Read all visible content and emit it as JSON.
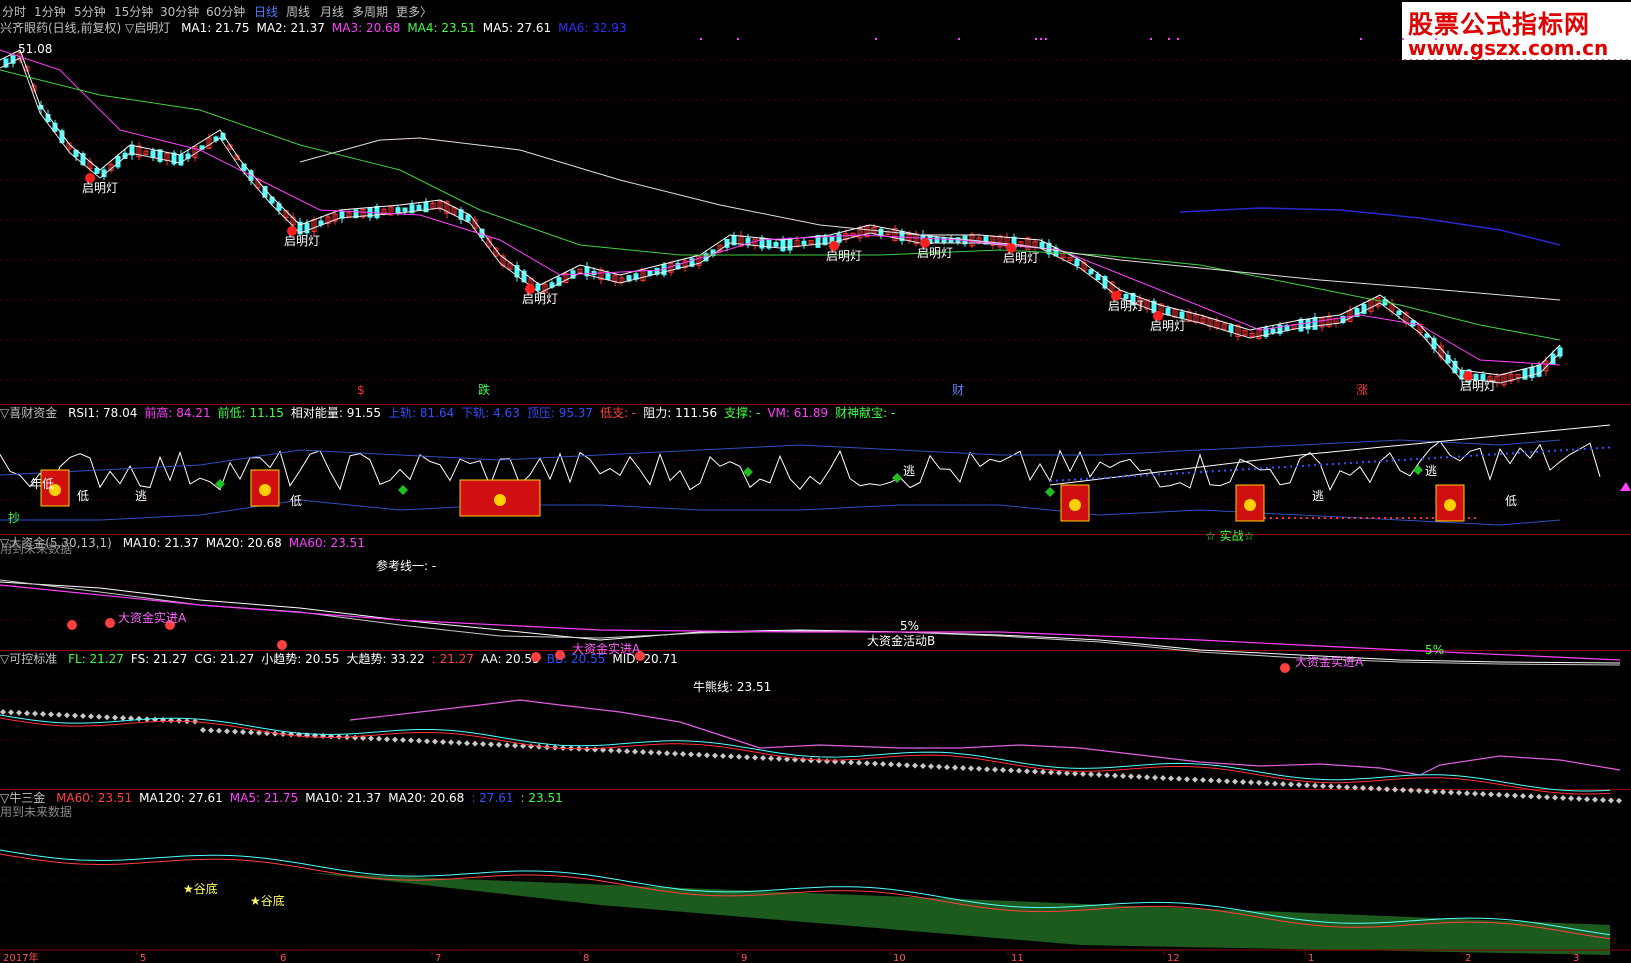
{
  "toolbar": {
    "tabs": [
      {
        "label": "分时"
      },
      {
        "label": "1分钟"
      },
      {
        "label": "5分钟"
      },
      {
        "label": "15分钟"
      },
      {
        "label": "30分钟"
      },
      {
        "label": "60分钟"
      },
      {
        "label": "日线",
        "active": true
      },
      {
        "label": "周线"
      },
      {
        "label": "月线"
      },
      {
        "label": "多周期"
      },
      {
        "label": "更多〉"
      }
    ]
  },
  "logo": {
    "line1": "股票公式指标网",
    "line2": "www.gszx.com.cn"
  },
  "panel1": {
    "title": "兴齐眼药(日线,前复权) ▽启明灯",
    "ma": [
      {
        "label": "MA1: 21.75",
        "color": "#ffffff"
      },
      {
        "label": "MA2: 21.37",
        "color": "#ffffff"
      },
      {
        "label": "MA3: 20.68",
        "color": "#ff40ff"
      },
      {
        "label": "MA4: 23.51",
        "color": "#40ff40"
      },
      {
        "label": "MA5: 27.61",
        "color": "#ffffff"
      },
      {
        "label": "MA6: 32.93",
        "color": "#3030ff"
      }
    ],
    "high_label": "51.08",
    "signal_label": "启明灯",
    "markers": [
      {
        "text": "$",
        "color": "#ff3030"
      },
      {
        "text": "跌",
        "color": "#40ff40"
      },
      {
        "text": "财",
        "color": "#6080ff"
      },
      {
        "text": "涨",
        "color": "#ff3030"
      }
    ]
  },
  "panel2": {
    "title": "▽喜财资金",
    "items": [
      {
        "label": "RSI1: 78.04",
        "color": "#ffffff"
      },
      {
        "label": "前高: 84.21",
        "color": "#ff40ff"
      },
      {
        "label": "前低: 11.15",
        "color": "#40ff40"
      },
      {
        "label": "相对能量: 91.55",
        "color": "#ffffff"
      },
      {
        "label": "上轨: 81.64",
        "color": "#3050ff"
      },
      {
        "label": "下轨: 4.63",
        "color": "#3050ff"
      },
      {
        "label": "顶压: 95.37",
        "color": "#3050ff"
      },
      {
        "label": "低支: -",
        "color": "#ff4040"
      },
      {
        "label": "阻力: 111.56",
        "color": "#ffffff"
      },
      {
        "label": "支撑: -",
        "color": "#40ff40"
      },
      {
        "label": "VM: 61.89",
        "color": "#ff40ff"
      },
      {
        "label": "财神献宝: -",
        "color": "#40ff40"
      }
    ],
    "future_note": "用到未来数据",
    "labels": {
      "nian_di": "年低",
      "di": "低",
      "tao": "逃",
      "chao": "抄",
      "shizhan": "☆ 实战☆"
    }
  },
  "panel3": {
    "title": "▽大资金(5,30,13,1)",
    "items": [
      {
        "label": "MA10: 21.37",
        "color": "#ffffff"
      },
      {
        "label": "MA20: 20.68",
        "color": "#ffffff"
      },
      {
        "label": "MA60: 23.51",
        "color": "#ff40ff"
      }
    ],
    "ref_line": "参考线一: -",
    "labels": {
      "a": "大资金实进A",
      "b": "大资金活动B",
      "pct": "5%"
    }
  },
  "panel4": {
    "title": "▽可控标准",
    "items": [
      {
        "label": "FL: 21.27",
        "color": "#40ff40"
      },
      {
        "label": "FS: 21.27",
        "color": "#ffffff"
      },
      {
        "label": "CG: 21.27",
        "color": "#ffffff"
      },
      {
        "label": "小趋势: 20.55",
        "color": "#ffffff"
      },
      {
        "label": "大趋势: 33.22",
        "color": "#ffffff"
      },
      {
        "label": ": 21.27",
        "color": "#ff4040"
      },
      {
        "label": "AA: 20.55",
        "color": "#ffffff"
      },
      {
        "label": "BB: 20.55",
        "color": "#3050ff"
      },
      {
        "label": "MID: 20.71",
        "color": "#ffffff"
      }
    ],
    "niu_line": "牛熊线: 23.51",
    "future_note": "用到未来数据"
  },
  "panel5": {
    "title": "▽牛三金",
    "items": [
      {
        "label": "MA60: 23.51",
        "color": "#ff4040"
      },
      {
        "label": "MA120: 27.61",
        "color": "#ffffff"
      },
      {
        "label": "MA5: 21.75",
        "color": "#ff40ff"
      },
      {
        "label": "MA10: 21.37",
        "color": "#ffffff"
      },
      {
        "label": "MA20: 20.68",
        "color": "#ffffff"
      }
    ],
    "extra": [
      {
        "label": ": 27.61",
        "color": "#3050ff"
      },
      {
        "label": ": 23.51",
        "color": "#40ff40"
      }
    ],
    "labels": {
      "gudi": "谷底"
    }
  },
  "xaxis": {
    "labels": [
      "2017年",
      "5",
      "6",
      "7",
      "8",
      "9",
      "10",
      "11",
      "12",
      "1",
      "2",
      "3"
    ]
  },
  "chart_data": {
    "type": "line",
    "title": "兴齐眼药(日线,前复权)",
    "xlabel": "",
    "ylabel": "",
    "series": [
      {
        "name": "MA5",
        "values": [
          48,
          45,
          40,
          36,
          33,
          32,
          31,
          30,
          28,
          24,
          23,
          22,
          21,
          22,
          23,
          21,
          19,
          18,
          17,
          16,
          15,
          17,
          14,
          13,
          21.75
        ]
      },
      {
        "name": "MA20",
        "values": [
          49,
          47,
          44,
          40,
          37,
          34,
          33,
          31,
          29,
          26,
          24,
          23,
          22,
          22,
          22,
          22,
          20,
          19,
          18,
          17,
          16,
          16,
          15,
          14,
          20.68
        ]
      },
      {
        "name": "MA60",
        "values": [
          50,
          49,
          47,
          45,
          43,
          41,
          39,
          36,
          33,
          30,
          28,
          26,
          25,
          25,
          24,
          24,
          23,
          22,
          21,
          20,
          19,
          18,
          17,
          16,
          23.51
        ]
      }
    ]
  }
}
